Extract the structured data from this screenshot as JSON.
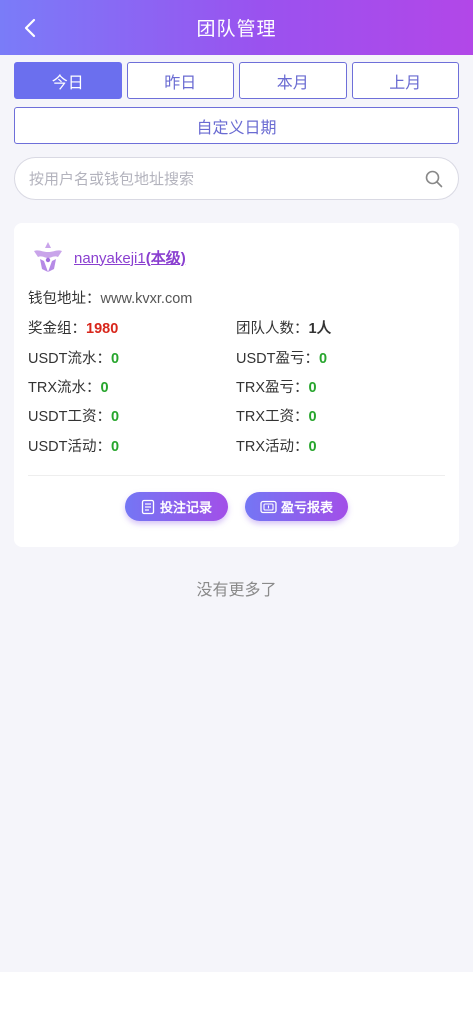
{
  "header": {
    "title": "团队管理",
    "back_icon": "back-chevron-icon"
  },
  "date_tabs": [
    {
      "label": "今日",
      "active": true
    },
    {
      "label": "昨日",
      "active": false
    },
    {
      "label": "本月",
      "active": false
    },
    {
      "label": "上月",
      "active": false
    }
  ],
  "custom_date_label": "自定义日期",
  "search": {
    "placeholder": "按用户名或钱包地址搜索",
    "value": "",
    "icon": "search-icon"
  },
  "member": {
    "username": "nanyakeji1",
    "level_tag": "(本级)",
    "wallet_label": "钱包地址：",
    "wallet_value": "www.kvxr.com",
    "bonus_group_label": "奖金组：",
    "bonus_group_value": "1980",
    "team_size_label": "团队人数：",
    "team_size_value": "1人",
    "usdt_flow_label": "USDT流水：",
    "usdt_flow_value": "0",
    "usdt_pnl_label": "USDT盈亏：",
    "usdt_pnl_value": "0",
    "trx_flow_label": "TRX流水：",
    "trx_flow_value": "0",
    "trx_pnl_label": "TRX盈亏：",
    "trx_pnl_value": "0",
    "usdt_salary_label": "USDT工资：",
    "usdt_salary_value": "0",
    "trx_salary_label": "TRX工资：",
    "trx_salary_value": "0",
    "usdt_activity_label": "USDT活动：",
    "usdt_activity_value": "0",
    "trx_activity_label": "TRX活动：",
    "trx_activity_value": "0",
    "bet_records_label": "投注记录",
    "pnl_report_label": "盈亏报表"
  },
  "footer_text": "没有更多了",
  "colors": {
    "accent": "#6b6fee",
    "header_gradient_end": "#b247e8",
    "positive": "#27a52d",
    "negative": "#d8261b",
    "username": "#8a3fd0"
  }
}
